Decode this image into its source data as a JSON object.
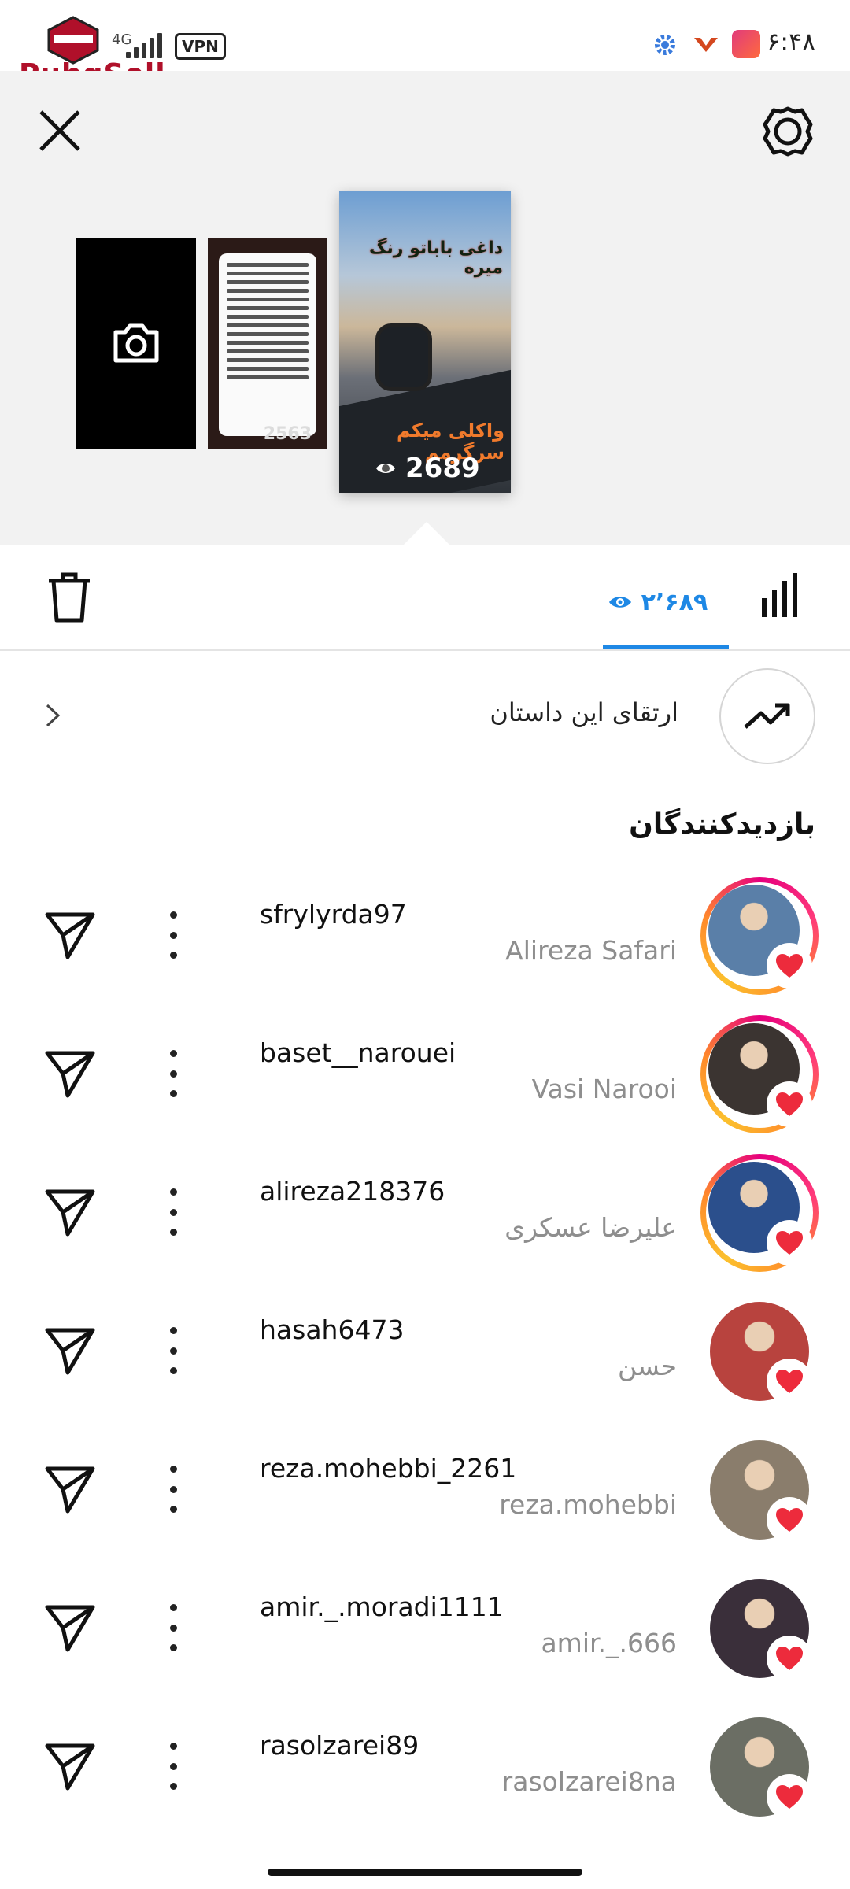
{
  "status_bar": {
    "network": "4G",
    "vpn": "VPN",
    "time": "۶:۴۸",
    "watermark": "PubgSell"
  },
  "header": {
    "close_icon": "close-icon",
    "settings_icon": "settings-icon",
    "stories": [
      {
        "type": "camera",
        "icon": "camera-icon"
      },
      {
        "type": "text-story",
        "count": "2563"
      },
      {
        "type": "photo-story",
        "overlay_top": "داغی باباتو رنگ میره",
        "overlay_bottom": "واکلی میکم سرگرمم",
        "count": "2689",
        "selected": true
      }
    ]
  },
  "tabs": {
    "trash_icon": "trash-icon",
    "views_count": "۲٬۶۸۹",
    "insights_icon": "bar-chart-icon"
  },
  "progress": {
    "label": "ارتقای این داستان"
  },
  "viewers": {
    "title": "بازدیدکنندگان",
    "items": [
      {
        "username": "sfrylyrda97",
        "name": "Alireza Safari",
        "ring": true,
        "avatar_color": "#5a7fa8"
      },
      {
        "username": "baset__narouei",
        "name": "Vasi Narooi",
        "ring": true,
        "avatar_color": "#3b3431"
      },
      {
        "username": "alireza218376",
        "name": "علیرضا عسکری",
        "ring": true,
        "avatar_color": "#2b4f8c"
      },
      {
        "username": "hasah6473",
        "name": "حسن",
        "ring": false,
        "avatar_color": "#b8433e"
      },
      {
        "username": "reza.mohebbi_2261",
        "name": "reza.mohebbi",
        "ring": false,
        "avatar_color": "#8a7d6c"
      },
      {
        "username": "amir._.moradi1111",
        "name": "amir._.666",
        "ring": false,
        "avatar_color": "#3a2f3a"
      },
      {
        "username": "rasolzarei89",
        "name": "rasolzarei8na",
        "ring": false,
        "avatar_color": "#6b6e64"
      }
    ],
    "heart_color": "#ed2b3c"
  },
  "colors": {
    "accent": "#1e88e5",
    "header_bg": "#f2f2f2"
  }
}
